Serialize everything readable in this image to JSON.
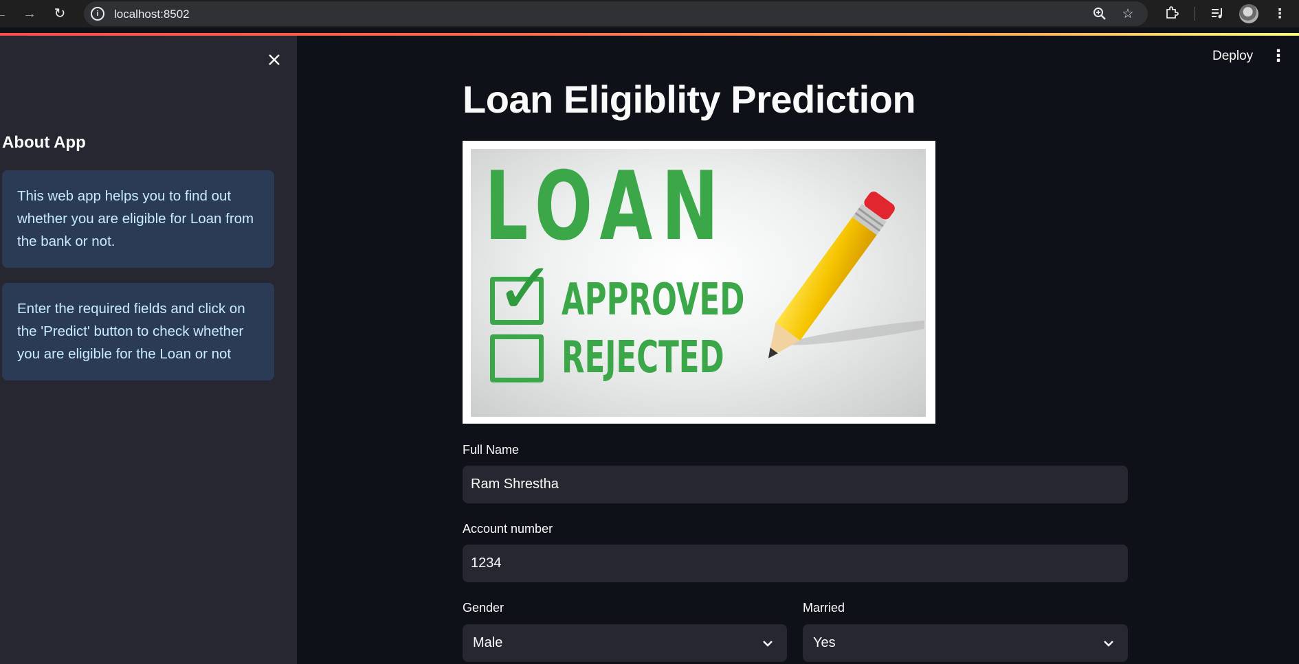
{
  "browser": {
    "url": "localhost:8502",
    "site_info_glyph": "i"
  },
  "sidebar": {
    "heading": "About App",
    "info_1": "This web app helps you to find out whether you are eligible for Loan from the bank or not.",
    "info_2": "Enter the required fields and click on the 'Predict' button to check whether you are eligible for the Loan or not"
  },
  "toolbar": {
    "deploy_label": "Deploy"
  },
  "main": {
    "title": "Loan Eligiblity Prediction",
    "hero_image": {
      "word": "LOAN",
      "approved": "APPROVED",
      "rejected": "REJECTED"
    },
    "full_name": {
      "label": "Full Name",
      "value": "Ram Shrestha"
    },
    "account_number": {
      "label": "Account number",
      "value": "1234"
    },
    "gender": {
      "label": "Gender",
      "value": "Male"
    },
    "married": {
      "label": "Married",
      "value": "Yes"
    }
  },
  "colors": {
    "background": "#0e1117",
    "sidebar_bg": "#262730",
    "info_bg": "#2b3b55",
    "info_text": "#c7ebff",
    "loan_green": "#3ba749",
    "accent": "#ff4b4b"
  },
  "icons": [
    "back-arrow-icon",
    "forward-arrow-icon",
    "reload-icon",
    "site-info-icon",
    "zoom-icon",
    "star-icon",
    "extensions-icon",
    "media-controls-icon",
    "profile-avatar",
    "chrome-menu-icon",
    "close-icon",
    "kebab-menu-icon",
    "chevron-down-icon"
  ]
}
